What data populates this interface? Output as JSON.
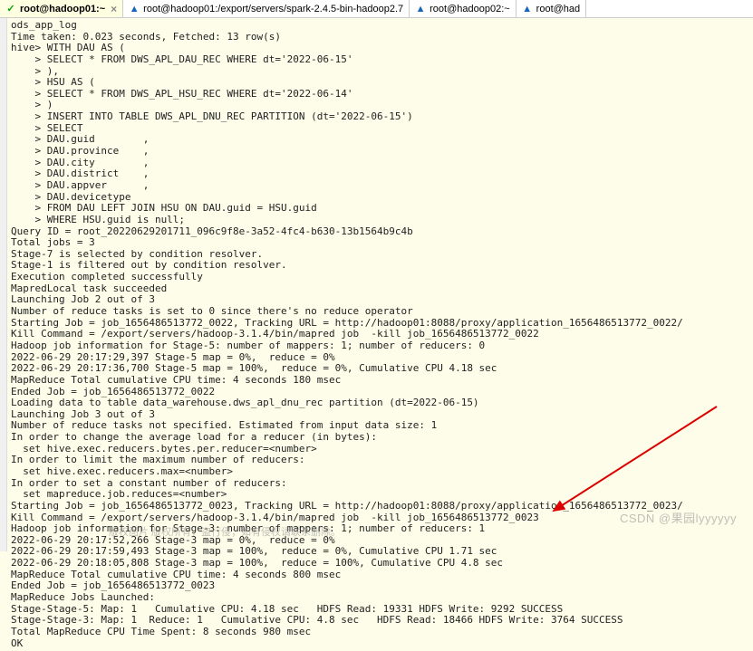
{
  "tabs": [
    {
      "label": "root@hadoop01:~",
      "icon": "check",
      "active": true,
      "close": true
    },
    {
      "label": "root@hadoop01:/export/servers/spark-2.4.5-bin-hadoop2.7",
      "icon": "warn",
      "active": false,
      "close": false
    },
    {
      "label": "root@hadoop02:~",
      "icon": "warn",
      "active": false,
      "close": false
    },
    {
      "label": "root@had",
      "icon": "warn",
      "active": false,
      "close": false
    }
  ],
  "terminal": {
    "lines": [
      "ods_app_log",
      "Time taken: 0.023 seconds, Fetched: 13 row(s)",
      "hive> WITH DAU AS (",
      "    > SELECT * FROM DWS_APL_DAU_REC WHERE dt='2022-06-15'",
      "    > ),",
      "    > HSU AS (",
      "    > SELECT * FROM DWS_APL_HSU_REC WHERE dt='2022-06-14'",
      "    > )",
      "    > INSERT INTO TABLE DWS_APL_DNU_REC PARTITION (dt='2022-06-15')",
      "    > SELECT",
      "    > DAU.guid        ,",
      "    > DAU.province    ,",
      "    > DAU.city        ,",
      "    > DAU.district    ,",
      "    > DAU.appver      ,",
      "    > DAU.devicetype",
      "    > FROM DAU LEFT JOIN HSU ON DAU.guid = HSU.guid",
      "    > WHERE HSU.guid is null;",
      "Query ID = root_20220629201711_096c9f8e-3a52-4fc4-b630-13b1564b9c4b",
      "Total jobs = 3",
      "Stage-7 is selected by condition resolver.",
      "Stage-1 is filtered out by condition resolver.",
      "Execution completed successfully",
      "MapredLocal task succeeded",
      "Launching Job 2 out of 3",
      "Number of reduce tasks is set to 0 since there's no reduce operator",
      "Starting Job = job_1656486513772_0022, Tracking URL = http://hadoop01:8088/proxy/application_1656486513772_0022/",
      "Kill Command = /export/servers/hadoop-3.1.4/bin/mapred job  -kill job_1656486513772_0022",
      "Hadoop job information for Stage-5: number of mappers: 1; number of reducers: 0",
      "2022-06-29 20:17:29,397 Stage-5 map = 0%,  reduce = 0%",
      "2022-06-29 20:17:36,700 Stage-5 map = 100%,  reduce = 0%, Cumulative CPU 4.18 sec",
      "MapReduce Total cumulative CPU time: 4 seconds 180 msec",
      "Ended Job = job_1656486513772_0022",
      "Loading data to table data_warehouse.dws_apl_dnu_rec partition (dt=2022-06-15)",
      "Launching Job 3 out of 3",
      "Number of reduce tasks not specified. Estimated from input data size: 1",
      "In order to change the average load for a reducer (in bytes):",
      "  set hive.exec.reducers.bytes.per.reducer=<number>",
      "In order to limit the maximum number of reducers:",
      "  set hive.exec.reducers.max=<number>",
      "In order to set a constant number of reducers:",
      "  set mapreduce.job.reduces=<number>",
      "Starting Job = job_1656486513772_0023, Tracking URL = http://hadoop01:8088/proxy/application_1656486513772_0023/",
      "Kill Command = /export/servers/hadoop-3.1.4/bin/mapred job  -kill job_1656486513772_0023",
      "Hadoop job information for Stage-3: number of mappers: 1; number of reducers: 1",
      "2022-06-29 20:17:52,266 Stage-3 map = 0%,  reduce = 0%",
      "2022-06-29 20:17:59,493 Stage-3 map = 100%,  reduce = 0%, Cumulative CPU 1.71 sec",
      "2022-06-29 20:18:05,808 Stage-3 map = 100%,  reduce = 100%, Cumulative CPU 4.8 sec",
      "MapReduce Total cumulative CPU time: 4 seconds 800 msec",
      "Ended Job = job_1656486513772_0023",
      "MapReduce Jobs Launched:",
      "Stage-Stage-5: Map: 1   Cumulative CPU: 4.18 sec   HDFS Read: 19331 HDFS Write: 9292 SUCCESS",
      "Stage-Stage-3: Map: 1  Reduce: 1   Cumulative CPU: 4.8 sec   HDFS Read: 18466 HDFS Write: 3764 SUCCESS",
      "Total MapReduce CPU Time Spent: 8 seconds 980 msec",
      "OK"
    ]
  },
  "watermark": "CSDN @果园lyyyyyy",
  "footer_note": "版权图片 版权所有，盗行侵；如有侵权请联系删除。",
  "icons": {
    "check": "✓",
    "warn": "▲",
    "close": "×"
  },
  "colors": {
    "check": "#0a0",
    "warn": "#1565c0",
    "arrow": "#d00"
  }
}
